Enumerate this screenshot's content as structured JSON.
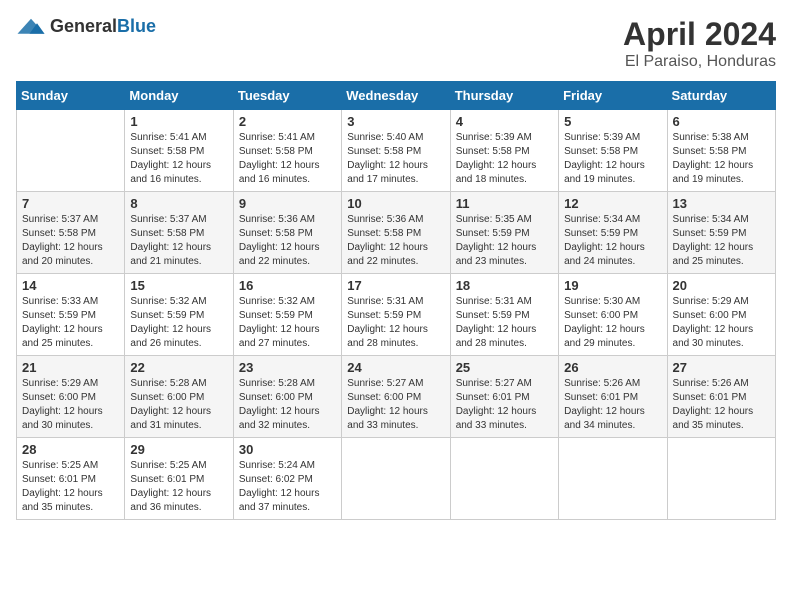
{
  "logo": {
    "general": "General",
    "blue": "Blue"
  },
  "title": {
    "month": "April 2024",
    "location": "El Paraiso, Honduras"
  },
  "calendar": {
    "headers": [
      "Sunday",
      "Monday",
      "Tuesday",
      "Wednesday",
      "Thursday",
      "Friday",
      "Saturday"
    ],
    "weeks": [
      [
        {
          "day": "",
          "sunrise": "",
          "sunset": "",
          "daylight": ""
        },
        {
          "day": "1",
          "sunrise": "Sunrise: 5:41 AM",
          "sunset": "Sunset: 5:58 PM",
          "daylight": "Daylight: 12 hours and 16 minutes."
        },
        {
          "day": "2",
          "sunrise": "Sunrise: 5:41 AM",
          "sunset": "Sunset: 5:58 PM",
          "daylight": "Daylight: 12 hours and 16 minutes."
        },
        {
          "day": "3",
          "sunrise": "Sunrise: 5:40 AM",
          "sunset": "Sunset: 5:58 PM",
          "daylight": "Daylight: 12 hours and 17 minutes."
        },
        {
          "day": "4",
          "sunrise": "Sunrise: 5:39 AM",
          "sunset": "Sunset: 5:58 PM",
          "daylight": "Daylight: 12 hours and 18 minutes."
        },
        {
          "day": "5",
          "sunrise": "Sunrise: 5:39 AM",
          "sunset": "Sunset: 5:58 PM",
          "daylight": "Daylight: 12 hours and 19 minutes."
        },
        {
          "day": "6",
          "sunrise": "Sunrise: 5:38 AM",
          "sunset": "Sunset: 5:58 PM",
          "daylight": "Daylight: 12 hours and 19 minutes."
        }
      ],
      [
        {
          "day": "7",
          "sunrise": "Sunrise: 5:37 AM",
          "sunset": "Sunset: 5:58 PM",
          "daylight": "Daylight: 12 hours and 20 minutes."
        },
        {
          "day": "8",
          "sunrise": "Sunrise: 5:37 AM",
          "sunset": "Sunset: 5:58 PM",
          "daylight": "Daylight: 12 hours and 21 minutes."
        },
        {
          "day": "9",
          "sunrise": "Sunrise: 5:36 AM",
          "sunset": "Sunset: 5:58 PM",
          "daylight": "Daylight: 12 hours and 22 minutes."
        },
        {
          "day": "10",
          "sunrise": "Sunrise: 5:36 AM",
          "sunset": "Sunset: 5:58 PM",
          "daylight": "Daylight: 12 hours and 22 minutes."
        },
        {
          "day": "11",
          "sunrise": "Sunrise: 5:35 AM",
          "sunset": "Sunset: 5:59 PM",
          "daylight": "Daylight: 12 hours and 23 minutes."
        },
        {
          "day": "12",
          "sunrise": "Sunrise: 5:34 AM",
          "sunset": "Sunset: 5:59 PM",
          "daylight": "Daylight: 12 hours and 24 minutes."
        },
        {
          "day": "13",
          "sunrise": "Sunrise: 5:34 AM",
          "sunset": "Sunset: 5:59 PM",
          "daylight": "Daylight: 12 hours and 25 minutes."
        }
      ],
      [
        {
          "day": "14",
          "sunrise": "Sunrise: 5:33 AM",
          "sunset": "Sunset: 5:59 PM",
          "daylight": "Daylight: 12 hours and 25 minutes."
        },
        {
          "day": "15",
          "sunrise": "Sunrise: 5:32 AM",
          "sunset": "Sunset: 5:59 PM",
          "daylight": "Daylight: 12 hours and 26 minutes."
        },
        {
          "day": "16",
          "sunrise": "Sunrise: 5:32 AM",
          "sunset": "Sunset: 5:59 PM",
          "daylight": "Daylight: 12 hours and 27 minutes."
        },
        {
          "day": "17",
          "sunrise": "Sunrise: 5:31 AM",
          "sunset": "Sunset: 5:59 PM",
          "daylight": "Daylight: 12 hours and 28 minutes."
        },
        {
          "day": "18",
          "sunrise": "Sunrise: 5:31 AM",
          "sunset": "Sunset: 5:59 PM",
          "daylight": "Daylight: 12 hours and 28 minutes."
        },
        {
          "day": "19",
          "sunrise": "Sunrise: 5:30 AM",
          "sunset": "Sunset: 6:00 PM",
          "daylight": "Daylight: 12 hours and 29 minutes."
        },
        {
          "day": "20",
          "sunrise": "Sunrise: 5:29 AM",
          "sunset": "Sunset: 6:00 PM",
          "daylight": "Daylight: 12 hours and 30 minutes."
        }
      ],
      [
        {
          "day": "21",
          "sunrise": "Sunrise: 5:29 AM",
          "sunset": "Sunset: 6:00 PM",
          "daylight": "Daylight: 12 hours and 30 minutes."
        },
        {
          "day": "22",
          "sunrise": "Sunrise: 5:28 AM",
          "sunset": "Sunset: 6:00 PM",
          "daylight": "Daylight: 12 hours and 31 minutes."
        },
        {
          "day": "23",
          "sunrise": "Sunrise: 5:28 AM",
          "sunset": "Sunset: 6:00 PM",
          "daylight": "Daylight: 12 hours and 32 minutes."
        },
        {
          "day": "24",
          "sunrise": "Sunrise: 5:27 AM",
          "sunset": "Sunset: 6:00 PM",
          "daylight": "Daylight: 12 hours and 33 minutes."
        },
        {
          "day": "25",
          "sunrise": "Sunrise: 5:27 AM",
          "sunset": "Sunset: 6:01 PM",
          "daylight": "Daylight: 12 hours and 33 minutes."
        },
        {
          "day": "26",
          "sunrise": "Sunrise: 5:26 AM",
          "sunset": "Sunset: 6:01 PM",
          "daylight": "Daylight: 12 hours and 34 minutes."
        },
        {
          "day": "27",
          "sunrise": "Sunrise: 5:26 AM",
          "sunset": "Sunset: 6:01 PM",
          "daylight": "Daylight: 12 hours and 35 minutes."
        }
      ],
      [
        {
          "day": "28",
          "sunrise": "Sunrise: 5:25 AM",
          "sunset": "Sunset: 6:01 PM",
          "daylight": "Daylight: 12 hours and 35 minutes."
        },
        {
          "day": "29",
          "sunrise": "Sunrise: 5:25 AM",
          "sunset": "Sunset: 6:01 PM",
          "daylight": "Daylight: 12 hours and 36 minutes."
        },
        {
          "day": "30",
          "sunrise": "Sunrise: 5:24 AM",
          "sunset": "Sunset: 6:02 PM",
          "daylight": "Daylight: 12 hours and 37 minutes."
        },
        {
          "day": "",
          "sunrise": "",
          "sunset": "",
          "daylight": ""
        },
        {
          "day": "",
          "sunrise": "",
          "sunset": "",
          "daylight": ""
        },
        {
          "day": "",
          "sunrise": "",
          "sunset": "",
          "daylight": ""
        },
        {
          "day": "",
          "sunrise": "",
          "sunset": "",
          "daylight": ""
        }
      ]
    ]
  }
}
